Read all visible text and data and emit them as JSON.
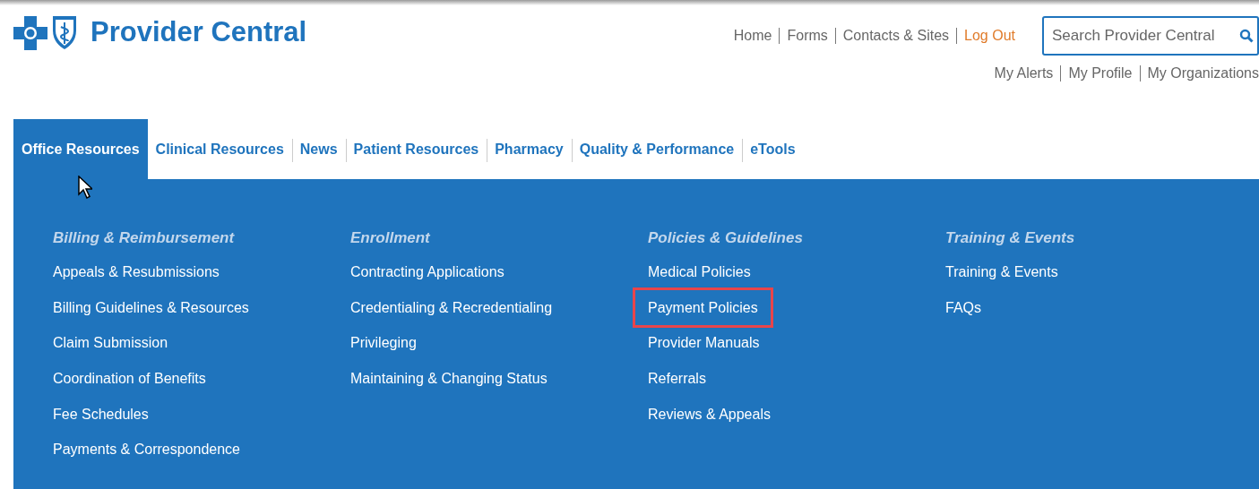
{
  "header": {
    "title": "Provider Central",
    "top_links": [
      {
        "label": "Home",
        "kind": "link"
      },
      {
        "label": "Forms",
        "kind": "link"
      },
      {
        "label": "Contacts & Sites",
        "kind": "link"
      },
      {
        "label": "Log Out",
        "kind": "logout"
      }
    ],
    "search": {
      "placeholder": "Search Provider Central"
    },
    "account_links": [
      {
        "label": "My Alerts"
      },
      {
        "label": "My Profile"
      },
      {
        "label": "My Organizations"
      }
    ]
  },
  "tabs": [
    {
      "label": "Office Resources",
      "selected": true
    },
    {
      "label": "Clinical Resources",
      "selected": false
    },
    {
      "label": "News",
      "selected": false
    },
    {
      "label": "Patient Resources",
      "selected": false
    },
    {
      "label": "Pharmacy",
      "selected": false
    },
    {
      "label": "Quality & Performance",
      "selected": false
    },
    {
      "label": "eTools",
      "selected": false
    }
  ],
  "menu": [
    {
      "heading": "Billing & Reimbursement",
      "items": [
        {
          "label": "Appeals & Resubmissions",
          "highlighted": false
        },
        {
          "label": "Billing Guidelines & Resources",
          "highlighted": false
        },
        {
          "label": "Claim Submission",
          "highlighted": false
        },
        {
          "label": "Coordination of Benefits",
          "highlighted": false
        },
        {
          "label": "Fee Schedules",
          "highlighted": false
        },
        {
          "label": "Payments & Correspondence",
          "highlighted": false
        }
      ]
    },
    {
      "heading": "Enrollment",
      "items": [
        {
          "label": "Contracting Applications",
          "highlighted": false
        },
        {
          "label": "Credentialing & Recredentialing",
          "highlighted": false
        },
        {
          "label": "Privileging",
          "highlighted": false
        },
        {
          "label": "Maintaining & Changing Status",
          "highlighted": false
        }
      ]
    },
    {
      "heading": "Policies & Guidelines",
      "items": [
        {
          "label": "Medical Policies",
          "highlighted": false
        },
        {
          "label": "Payment Policies",
          "highlighted": true
        },
        {
          "label": "Provider Manuals",
          "highlighted": false
        },
        {
          "label": "Referrals",
          "highlighted": false
        },
        {
          "label": "Reviews & Appeals",
          "highlighted": false
        }
      ]
    },
    {
      "heading": "Training & Events",
      "items": [
        {
          "label": "Training & Events",
          "highlighted": false
        },
        {
          "label": "FAQs",
          "highlighted": false
        }
      ]
    }
  ]
}
